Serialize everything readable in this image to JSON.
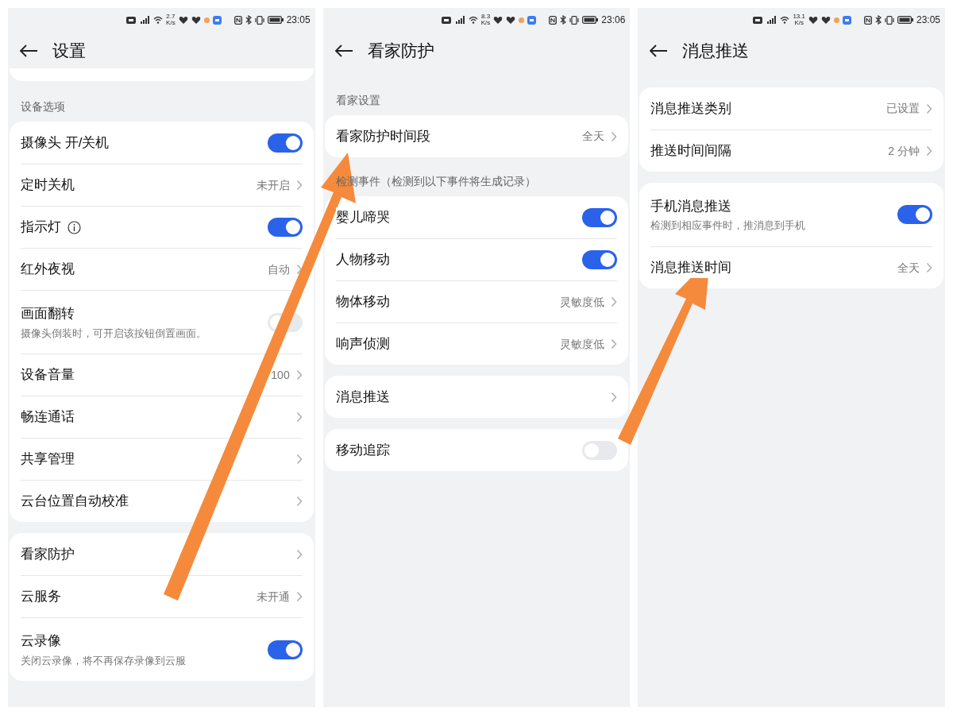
{
  "screens": [
    {
      "status": {
        "speed": "2.7",
        "speed_unit": "K/s",
        "time": "23:05"
      },
      "title": "设置",
      "sections": [
        {
          "kind": "stub"
        },
        {
          "header": "设备选项",
          "rows": [
            {
              "kind": "toggle",
              "label": "摄像头 开/关机",
              "on": true
            },
            {
              "kind": "link",
              "label": "定时关机",
              "value": "未开启"
            },
            {
              "kind": "toggle",
              "label": "指示灯",
              "on": true,
              "info": true
            },
            {
              "kind": "link",
              "label": "红外夜视",
              "value": "自动"
            },
            {
              "kind": "toggle",
              "label": "画面翻转",
              "on": false,
              "subtitle": "摄像头倒装时，可开启该按钮倒置画面。"
            },
            {
              "kind": "link",
              "label": "设备音量",
              "value": "100"
            },
            {
              "kind": "link",
              "label": "畅连通话"
            },
            {
              "kind": "link",
              "label": "共享管理"
            },
            {
              "kind": "link",
              "label": "云台位置自动校准"
            }
          ]
        },
        {
          "rows": [
            {
              "kind": "link",
              "label": "看家防护"
            },
            {
              "kind": "link",
              "label": "云服务",
              "value": "未开通"
            },
            {
              "kind": "toggle",
              "label": "云录像",
              "on": true,
              "subtitle": "关闭云录像，将不再保存录像到云服"
            }
          ]
        }
      ]
    },
    {
      "status": {
        "speed": "8.3",
        "speed_unit": "K/s",
        "time": "23:06"
      },
      "title": "看家防护",
      "sections": [
        {
          "header": "看家设置",
          "rows": [
            {
              "kind": "link",
              "label": "看家防护时间段",
              "value": "全天"
            }
          ]
        },
        {
          "header": "检测事件（检测到以下事件将生成记录）",
          "rows": [
            {
              "kind": "toggle",
              "label": "婴儿啼哭",
              "on": true
            },
            {
              "kind": "toggle",
              "label": "人物移动",
              "on": true
            },
            {
              "kind": "link",
              "label": "物体移动",
              "value": "灵敏度低"
            },
            {
              "kind": "link",
              "label": "响声侦测",
              "value": "灵敏度低"
            }
          ]
        },
        {
          "rows": [
            {
              "kind": "link",
              "label": "消息推送"
            }
          ]
        },
        {
          "rows": [
            {
              "kind": "toggle",
              "label": "移动追踪",
              "on": false
            }
          ]
        }
      ]
    },
    {
      "status": {
        "speed": "13.1",
        "speed_unit": "K/s",
        "time": "23:05"
      },
      "title": "消息推送",
      "sections": [
        {
          "rows": [
            {
              "kind": "link",
              "label": "消息推送类别",
              "value": "已设置"
            },
            {
              "kind": "link",
              "label": "推送时间间隔",
              "value": "2 分钟"
            }
          ]
        },
        {
          "rows": [
            {
              "kind": "toggle",
              "label": "手机消息推送",
              "on": true,
              "subtitle": "检测到相应事件时，推消息到手机"
            },
            {
              "kind": "link",
              "label": "消息推送时间",
              "value": "全天"
            }
          ]
        }
      ]
    }
  ]
}
